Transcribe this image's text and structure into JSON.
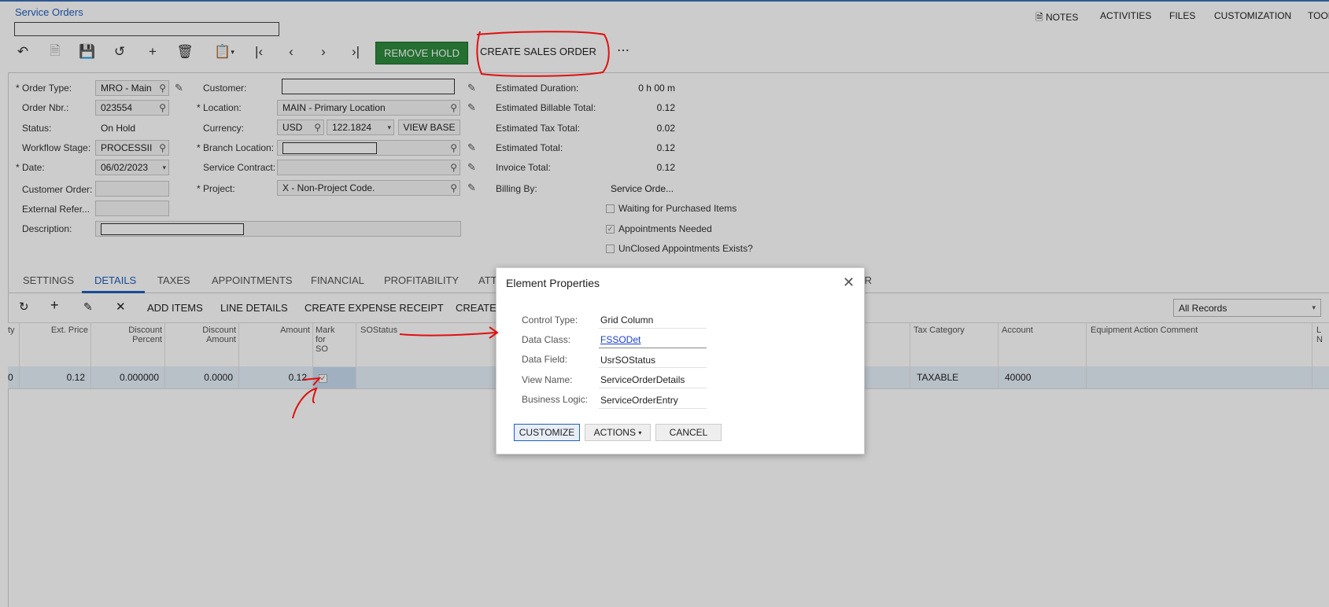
{
  "header": {
    "title": "Service Orders",
    "menu": [
      "NOTES",
      "ACTIVITIES",
      "FILES",
      "CUSTOMIZATION",
      "TOOL"
    ]
  },
  "toolbar": {
    "remove_hold": "REMOVE HOLD",
    "create_sales_order": "CREATE SALES ORDER",
    "more": "⋯"
  },
  "form": {
    "order_type_label": "Order Type:",
    "order_type": "MRO - Main",
    "order_nbr_label": "Order Nbr.:",
    "order_nbr": "023554",
    "status_label": "Status:",
    "status": "On Hold",
    "workflow_label": "Workflow Stage:",
    "workflow": "PROCESSII",
    "date_label": "Date:",
    "date": "06/02/2023",
    "customer_order_label": "Customer Order:",
    "external_ref_label": "External Refer...",
    "description_label": "Description:",
    "customer_label": "Customer:",
    "location_label": "Location:",
    "location": "MAIN - Primary Location",
    "currency_label": "Currency:",
    "currency": "USD",
    "rate": "122.1824",
    "view_base": "VIEW BASE",
    "branch_location_label": "Branch Location:",
    "service_contract_label": "Service Contract:",
    "project_label": "Project:",
    "project": "X - Non-Project Code.",
    "est_duration_label": "Estimated Duration:",
    "est_duration": "0 h 00 m",
    "est_billable_label": "Estimated Billable Total:",
    "est_billable": "0.12",
    "est_tax_label": "Estimated Tax Total:",
    "est_tax": "0.02",
    "est_total_label": "Estimated Total:",
    "est_total": "0.12",
    "invoice_total_label": "Invoice Total:",
    "invoice_total": "0.12",
    "billing_by_label": "Billing By:",
    "billing_by": "Service Orde...",
    "waiting_label": "Waiting for Purchased Items",
    "appts_needed_label": "Appointments Needed",
    "unclosed_label": "UnClosed Appointments Exists?"
  },
  "tabs": [
    "SETTINGS",
    "DETAILS",
    "TAXES",
    "APPOINTMENTS",
    "FINANCIAL",
    "PROFITABILITY",
    "ATT",
    "ER"
  ],
  "grid_toolbar": {
    "add_items": "ADD ITEMS",
    "line_details": "LINE DETAILS",
    "create_expense_receipt": "CREATE EXPENSE RECEIPT",
    "create": "CREATE",
    "filter": "All Records"
  },
  "grid": {
    "headers": {
      "qty": "ty",
      "ext_price": "Ext. Price",
      "disc_pct_1": "Discount",
      "disc_pct_2": "Percent",
      "disc_amt_1": "Discount",
      "disc_amt_2": "Amount",
      "amount": "Amount",
      "mark_1": "Mark",
      "mark_2": "for",
      "mark_3": "SO",
      "sostatus": "SOStatus",
      "tax_category": "Tax Category",
      "account": "Account",
      "equip_comment": "Equipment Action Comment",
      "last_1": "L",
      "last_2": "N"
    },
    "row": {
      "qty": "0",
      "ext_price": "0.12",
      "disc_pct": "0.000000",
      "disc_amt": "0.0000",
      "amount": "0.12",
      "tax_category": "TAXABLE",
      "account": "40000"
    }
  },
  "dialog": {
    "title": "Element Properties",
    "control_type_label": "Control Type:",
    "control_type": "Grid Column",
    "data_class_label": "Data Class:",
    "data_class": "FSSODet",
    "data_field_label": "Data Field:",
    "data_field": "UsrSOStatus",
    "view_name_label": "View Name:",
    "view_name": "ServiceOrderDetails",
    "business_logic_label": "Business Logic:",
    "business_logic": "ServiceOrderEntry",
    "customize": "CUSTOMIZE",
    "actions": "ACTIONS",
    "cancel": "CANCEL"
  },
  "colors": {
    "accent": "#1f5fbf",
    "green": "#2e8b3e",
    "annotation": "#e01010"
  }
}
